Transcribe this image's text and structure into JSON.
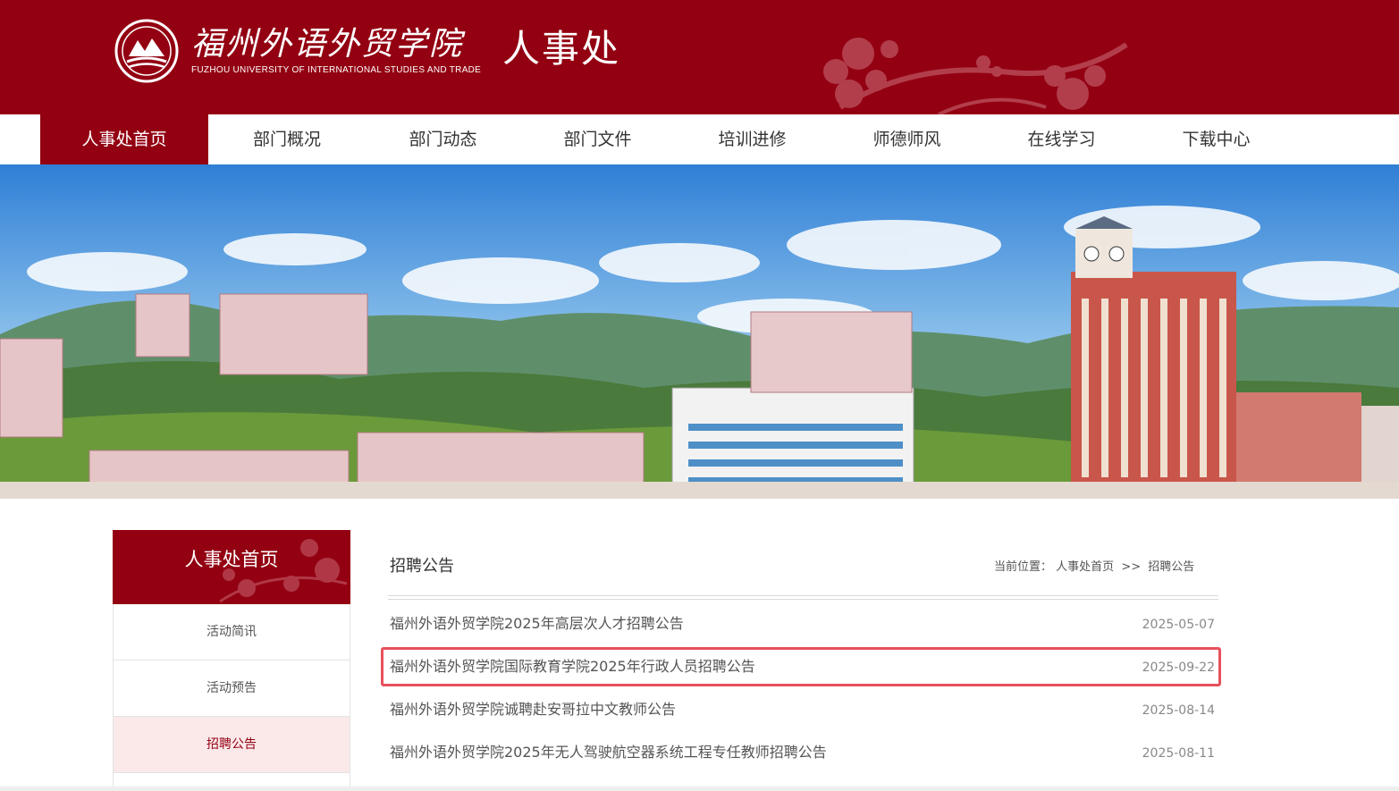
{
  "header": {
    "school_name_cn": "福州外语外贸学院",
    "school_name_en": "FUZHOU UNIVERSITY OF INTERNATIONAL STUDIES AND TRADE",
    "dept_title": "人事处",
    "colors": {
      "brand_red": "#930012",
      "highlight": "#e8505b"
    }
  },
  "nav": {
    "items": [
      {
        "label": "人事处首页",
        "active": true
      },
      {
        "label": "部门概况"
      },
      {
        "label": "部门动态"
      },
      {
        "label": "部门文件"
      },
      {
        "label": "培训进修"
      },
      {
        "label": "师德师风"
      },
      {
        "label": "在线学习"
      },
      {
        "label": "下载中心"
      }
    ]
  },
  "sidebar": {
    "title": "人事处首页",
    "items": [
      {
        "label": "活动简讯"
      },
      {
        "label": "活动预告"
      },
      {
        "label": "招聘公告",
        "active": true
      }
    ]
  },
  "content": {
    "title": "招聘公告",
    "breadcrumb": {
      "prefix": "当前位置：",
      "home": "人事处首页",
      "separator": ">>",
      "current": "招聘公告"
    },
    "news": [
      {
        "title": "福州外语外贸学院2025年高层次人才招聘公告",
        "date": "2025-05-07"
      },
      {
        "title": "福州外语外贸学院国际教育学院2025年行政人员招聘公告",
        "date": "2025-09-22",
        "highlighted": true
      },
      {
        "title": "福州外语外贸学院诚聘赴安哥拉中文教师公告",
        "date": "2025-08-14"
      },
      {
        "title": "福州外语外贸学院2025年无人驾驶航空器系统工程专任教师招聘公告",
        "date": "2025-08-11"
      }
    ]
  }
}
